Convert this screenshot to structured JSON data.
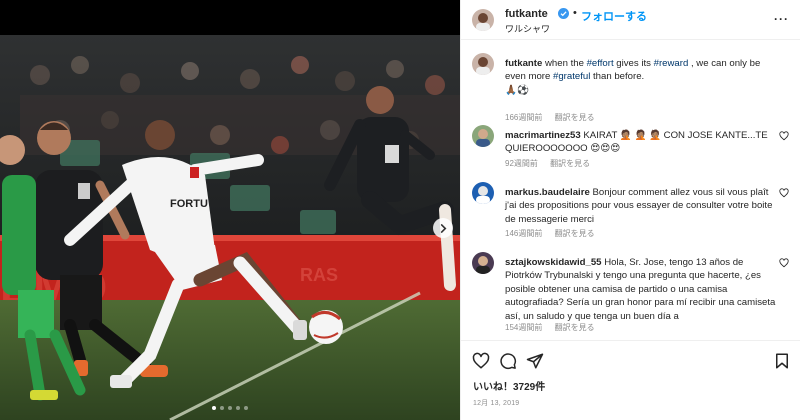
{
  "post": {
    "username": "futkante",
    "follow_label": "フォローする",
    "location": "ワルシャワ",
    "likes_label": "いいね！3729件",
    "date": "12月 13, 2019"
  },
  "caption": {
    "username": "futkante",
    "parts": [
      "when the ",
      "#effort",
      " gives its ",
      "#reward",
      " , we can only be even more ",
      "#grateful",
      " than before."
    ],
    "emoji": "🙏🏾⚽️",
    "time": "166週間前",
    "translate": "翻訳を見る"
  },
  "comments": [
    {
      "username": "macrimartinez53",
      "text": "KAIRAT 🤦🏽 🤦🏽 🤦🏽  CON JOSE KANTE...TE QUIEROOOOOOO 😍😍😍",
      "time": "92週間前",
      "like_label": "",
      "translate": "翻訳を見る"
    },
    {
      "username": "markus.baudelaire",
      "text": "Bonjour comment allez vous sil vous plaît j'ai des propositions pour vous essayer de consulter votre boite de messagerie merci",
      "time": "146週間前",
      "translate": "翻訳を見る"
    },
    {
      "username": "sztajkowskidawid_55",
      "text": "Hola, Sr. Jose, tengo 13 años de Piotrków Trybunalski y tengo una pregunta que hacerte, ¿es posible obtener una camisa de partido o una camisa autografiada? Sería un gran honor para mí recibir una camiseta así, un saludo y que tenga un buen día a",
      "time": "154週間前",
      "translate": "翻訳を見る"
    }
  ],
  "icons": {
    "like": "heart-icon",
    "comment": "comment-icon",
    "share": "paper-plane-icon",
    "save": "bookmark-icon",
    "more": "more-icon",
    "next": "chevron-right-icon",
    "verified": "verified-badge-icon"
  },
  "colors": {
    "accent": "#0095f6",
    "hashtag": "#00376b",
    "muted": "#8e8e8e",
    "text": "#262626"
  },
  "carousel": {
    "count": 5,
    "active": 0
  }
}
